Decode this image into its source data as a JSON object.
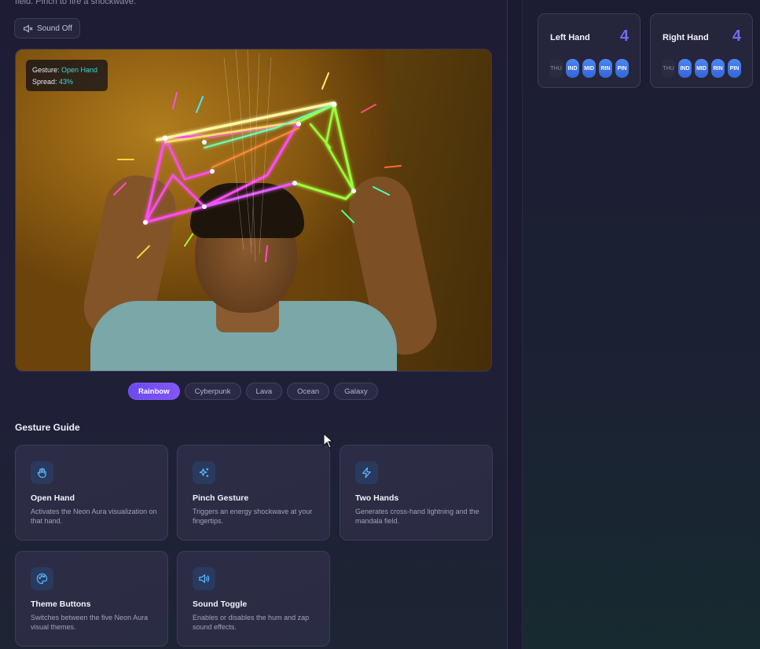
{
  "intro": {
    "text": "field. Pinch to fire a shockwave."
  },
  "sound_button": {
    "label": "Sound Off",
    "icon": "speaker-muted-icon"
  },
  "hud": {
    "gesture_label": "Gesture:",
    "gesture_value": "Open  Hand",
    "spread_label": "Spread:",
    "spread_value": "43%"
  },
  "themes": [
    {
      "label": "Rainbow",
      "active": true
    },
    {
      "label": "Cyberpunk",
      "active": false
    },
    {
      "label": "Lava",
      "active": false
    },
    {
      "label": "Ocean",
      "active": false
    },
    {
      "label": "Galaxy",
      "active": false
    }
  ],
  "guide": {
    "title": "Gesture Guide",
    "cards": [
      {
        "icon": "hand-icon",
        "title": "Open Hand",
        "desc": "Activates the Neon Aura visualization on that hand."
      },
      {
        "icon": "sparkles-icon",
        "title": "Pinch Gesture",
        "desc": "Triggers an energy shockwave at your fingertips."
      },
      {
        "icon": "lightning-icon",
        "title": "Two Hands",
        "desc": "Generates cross-hand lightning and the mandala field."
      },
      {
        "icon": "palette-icon",
        "title": "Theme Buttons",
        "desc": "Switches between the five Neon Aura visual themes."
      },
      {
        "icon": "speaker-icon",
        "title": "Sound Toggle",
        "desc": "Enables or disables the hum and zap sound effects."
      }
    ]
  },
  "hands": {
    "left": {
      "title": "Left Hand",
      "count": "4",
      "fingers": [
        {
          "label": "THU",
          "on": false
        },
        {
          "label": "IND",
          "on": true
        },
        {
          "label": "MID",
          "on": true
        },
        {
          "label": "RIN",
          "on": true
        },
        {
          "label": "PIN",
          "on": true
        }
      ]
    },
    "right": {
      "title": "Right Hand",
      "count": "4",
      "fingers": [
        {
          "label": "THU",
          "on": false
        },
        {
          "label": "IND",
          "on": true
        },
        {
          "label": "MID",
          "on": true
        },
        {
          "label": "RIN",
          "on": true
        },
        {
          "label": "PIN",
          "on": true
        }
      ]
    }
  },
  "colors": {
    "accent": "#7d5cf7",
    "finger_on": "#3f78e6",
    "count": "#6f6cf0",
    "hud_value": "#3ad8d8"
  }
}
